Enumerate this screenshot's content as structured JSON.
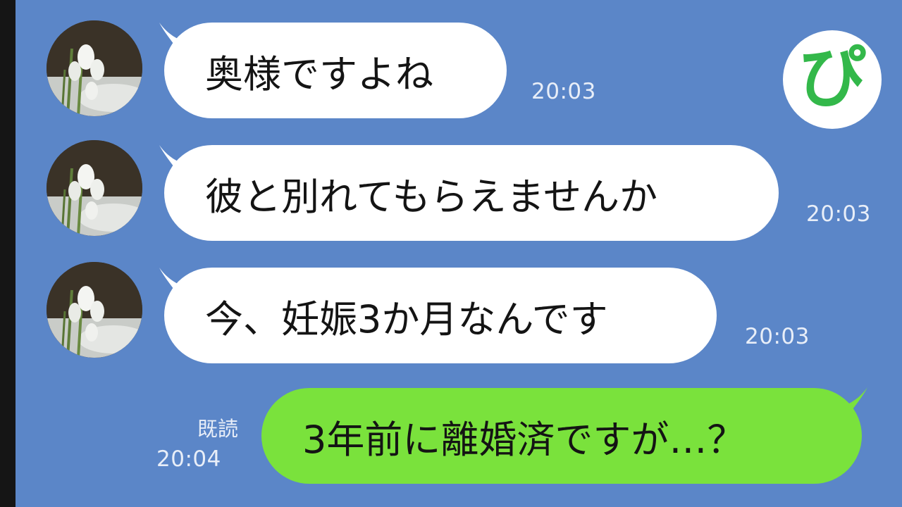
{
  "messages": [
    {
      "text": "奥様ですよね",
      "time": "20:03"
    },
    {
      "text": "彼と別れてもらえませんか",
      "time": "20:03"
    },
    {
      "text": "今、妊娠3か月なんです",
      "time": "20:03"
    }
  ],
  "reply": {
    "text": "3年前に離婚済ですが…？",
    "read_label": "既読",
    "time": "20:04"
  },
  "logo": {
    "text": "ぴ"
  },
  "colors": {
    "background": "#5b86c8",
    "incoming": "#ffffff",
    "outgoing": "#7ae23c",
    "logo_green": "#33b84a"
  },
  "icons": {
    "avatar": "snowdrop-flower-avatar-icon"
  }
}
